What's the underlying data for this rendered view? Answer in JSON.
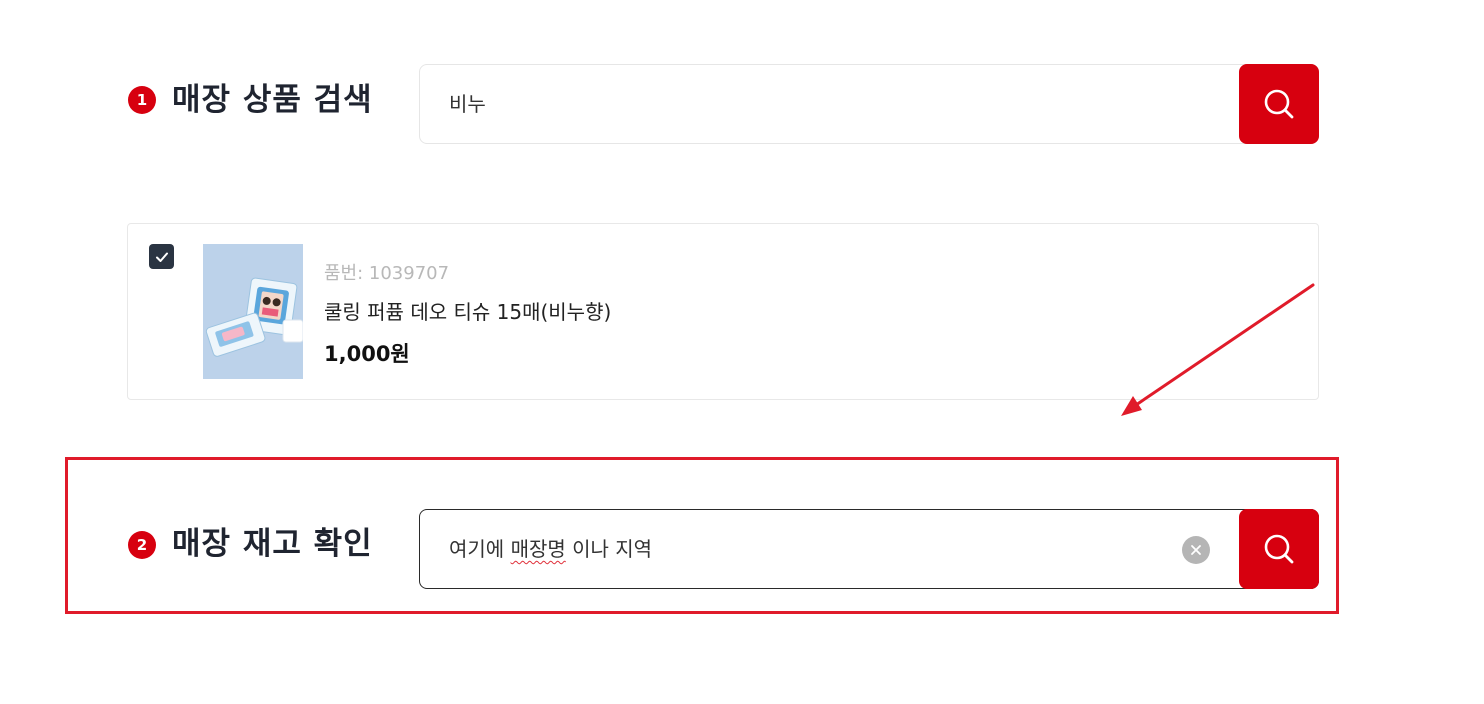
{
  "section1": {
    "step_number": "1",
    "title": "매장 상품 검색",
    "search_value": "비누"
  },
  "product": {
    "code_label": "품번: 1039707",
    "name": "쿨링 퍼퓸 데오 티슈 15매(비누향)",
    "price": "1,000원",
    "checked": true
  },
  "section2": {
    "step_number": "2",
    "title": "매장 재고 확인",
    "search_value_part1": "여기에 ",
    "search_value_part2": "매장명",
    "search_value_part3": " 이나 지역"
  },
  "icons": {
    "search": "search-icon",
    "clear": "close-icon",
    "check": "check-icon",
    "annotation_arrow": "arrow-icon"
  },
  "colors": {
    "accent": "#d7000f",
    "highlight": "#e01b2a",
    "checkbox": "#2a3442",
    "title": "#1f2430"
  }
}
